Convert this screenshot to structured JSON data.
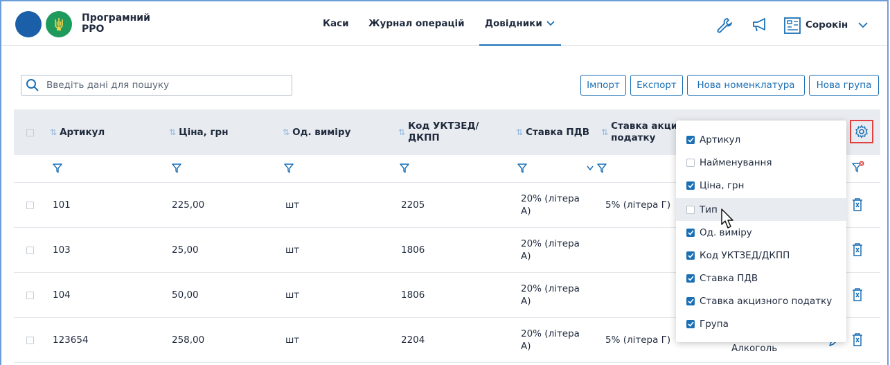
{
  "app": {
    "title_line1": "Програмний",
    "title_line2": "РРО"
  },
  "nav": {
    "items": [
      {
        "label": "Каси"
      },
      {
        "label": "Журнал операцій"
      },
      {
        "label": "Довідники"
      }
    ],
    "active": "Довідники"
  },
  "user": {
    "name": "Сорокін"
  },
  "search": {
    "placeholder": "Введіть дані для пошуку"
  },
  "toolbar": {
    "import_label": "Імпорт",
    "export_label": "Експорт",
    "new_item_label": "Нова номенклатура",
    "new_group_label": "Нова група"
  },
  "table": {
    "columns": [
      {
        "label": "Артикул"
      },
      {
        "label": "Ціна, грн"
      },
      {
        "label": "Од. виміру"
      },
      {
        "label_line1": "Код УКТЗЕД/",
        "label_line2": "ДКПП"
      },
      {
        "label": "Ставка ПДВ"
      },
      {
        "label_line1": "Ставка акцизного",
        "label_line2": "податку"
      }
    ],
    "rows": [
      {
        "article": "101",
        "price": "225,00",
        "unit": "шт",
        "code": "2205",
        "vat_line1": "20% (літера",
        "vat_line2": "А)",
        "excise": "5% (літера Г)",
        "group": ""
      },
      {
        "article": "103",
        "price": "25,00",
        "unit": "шт",
        "code": "1806",
        "vat_line1": "20% (літера",
        "vat_line2": "А)",
        "excise": "",
        "group": ""
      },
      {
        "article": "104",
        "price": "50,00",
        "unit": "шт",
        "code": "1806",
        "vat_line1": "20% (літера",
        "vat_line2": "А)",
        "excise": "",
        "group": ""
      },
      {
        "article": "123654",
        "price": "258,00",
        "unit": "шт",
        "code": "2204",
        "vat_line1": "20% (літера",
        "vat_line2": "А)",
        "excise": "5% (літера Г)",
        "group": "Алкоголь"
      }
    ]
  },
  "column_menu": {
    "items": [
      {
        "label": "Артикул",
        "checked": true
      },
      {
        "label": "Найменування",
        "checked": false
      },
      {
        "label": "Ціна, грн",
        "checked": true
      },
      {
        "label": "Тип",
        "checked": false,
        "hovered": true
      },
      {
        "label": "Од. виміру",
        "checked": true
      },
      {
        "label": "Код УКТЗЕД/ДКПП",
        "checked": true
      },
      {
        "label": "Ставка ПДВ",
        "checked": true
      },
      {
        "label": "Ставка акцизного податку",
        "checked": true
      },
      {
        "label": "Група",
        "checked": true
      }
    ]
  },
  "colors": {
    "accent": "#1a6fb5",
    "logo_blue": "#1a5fa8",
    "logo_green": "#1f9a5d",
    "header_bg": "#e8ebef",
    "highlight_border": "#e04040"
  },
  "icons": {
    "header": [
      "wrench-icon",
      "megaphone-icon",
      "cash-register-icon",
      "chevron-down-icon"
    ],
    "table": [
      "sort-icon",
      "filter-icon",
      "clear-filter-icon",
      "trash-icon",
      "edit-icon",
      "gear-icon"
    ]
  }
}
